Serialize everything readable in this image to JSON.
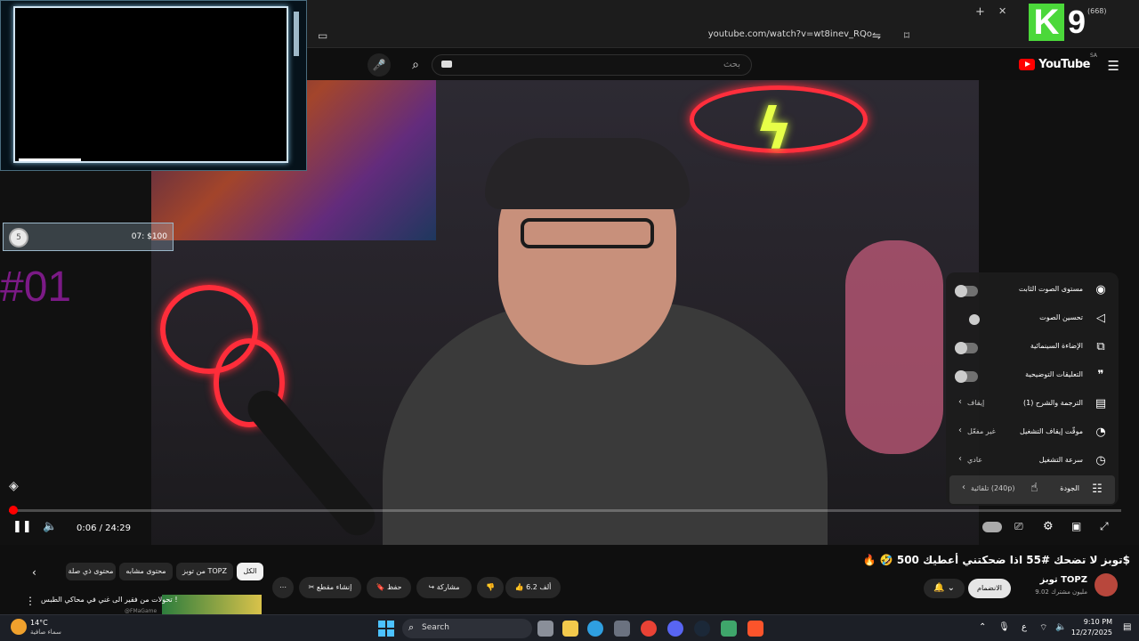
{
  "browser": {
    "url": "youtube.com/watch?v=wt8inev_RQo",
    "tab_count_label": "(668)"
  },
  "youtube": {
    "logo_text": "YouTube",
    "region": "SA",
    "search_placeholder": "بحث"
  },
  "player": {
    "time": "0:06 / 24:29",
    "progress_fraction": 0.004
  },
  "settings_menu": {
    "items": [
      {
        "label": "مستوى الصوت الثابت",
        "type": "toggle",
        "on": false,
        "icon": "stable-volume-icon"
      },
      {
        "label": "تحسين الصوت",
        "type": "toggle",
        "on": false,
        "icon": "voice-boost-icon"
      },
      {
        "label": "الإضاءة السينمائية",
        "type": "toggle",
        "on": false,
        "icon": "ambient-mode-icon"
      },
      {
        "label": "التعليقات التوضيحية",
        "type": "toggle",
        "on": false,
        "icon": "annotations-icon"
      },
      {
        "label": "الترجمة والشرح (1)",
        "value": "إيقاف",
        "icon": "subtitles-icon"
      },
      {
        "label": "موقّت إيقاف التشغيل",
        "value": "غير مفعّل",
        "icon": "sleep-timer-icon"
      },
      {
        "label": "سرعة التشغيل",
        "value": "عادي",
        "icon": "playback-speed-icon"
      },
      {
        "label": "الجودة",
        "value": "تلقائية (240p)",
        "icon": "quality-icon"
      }
    ]
  },
  "overlays": {
    "stream_goal": "07: $100",
    "coin": "5",
    "episode_tag": "#01",
    "k9_letter": "K",
    "k9_number": "9"
  },
  "video": {
    "title": "🔥 🤣 توبز لا تضحك #55 اذا ضحكتني أعطيك 500$",
    "channel": "توبز TOPZ",
    "subscribers": "9.02 مليون مشترك",
    "join_label": "الانضمام",
    "likes": "6.2 ألف",
    "share_label": "مشاركة",
    "save_label": "حفظ",
    "clip_label": "إنشاء مقطع"
  },
  "chips": [
    "الكل",
    "من توبز TOPZ",
    "محتوى مشابه",
    "محتوى ذي صلة"
  ],
  "recommendation": {
    "title": "تحولات من فقير الى غني في محاكي الطبس !",
    "by": "@FMaGame"
  },
  "taskbar": {
    "temperature": "14°C",
    "weather": "سماء صافية",
    "search": "Search",
    "time": "9:10 PM",
    "date": "12/27/2025",
    "lang": "ع"
  }
}
